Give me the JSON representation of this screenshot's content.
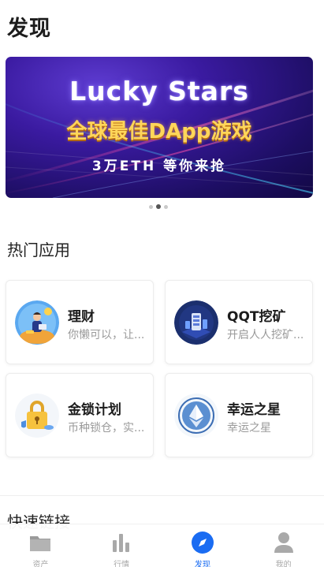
{
  "page": {
    "title": "发现"
  },
  "banner": {
    "title": "Lucky Stars",
    "subtitle": "全球最佳DApp游戏",
    "caption": "3万ETH 等你来抢",
    "active_index": 1,
    "count": 3
  },
  "sections": {
    "hot": "热门应用",
    "quick": "快速链接"
  },
  "apps": [
    {
      "name": "理财",
      "desc": "你懒可以，让...",
      "icon": "finance-person-icon"
    },
    {
      "name": "QQT挖矿",
      "desc": "开启人人挖矿...",
      "icon": "mining-icon"
    },
    {
      "name": "金锁计划",
      "desc": "币种锁仓，实...",
      "icon": "gold-lock-icon"
    },
    {
      "name": "幸运之星",
      "desc": "幸运之星",
      "icon": "ethereum-icon"
    }
  ],
  "tabbar": {
    "items": [
      {
        "label": "资产",
        "icon": "wallet-folder-icon",
        "active": false
      },
      {
        "label": "行情",
        "icon": "bar-chart-icon",
        "active": false
      },
      {
        "label": "发现",
        "icon": "compass-icon",
        "active": true
      },
      {
        "label": "我的",
        "icon": "profile-icon",
        "active": false
      }
    ]
  },
  "colors": {
    "accent": "#1a6cf2",
    "inactive": "#a9a9a9",
    "banner_bg": "#2a1282",
    "banner_highlight": "#ffd65a"
  }
}
